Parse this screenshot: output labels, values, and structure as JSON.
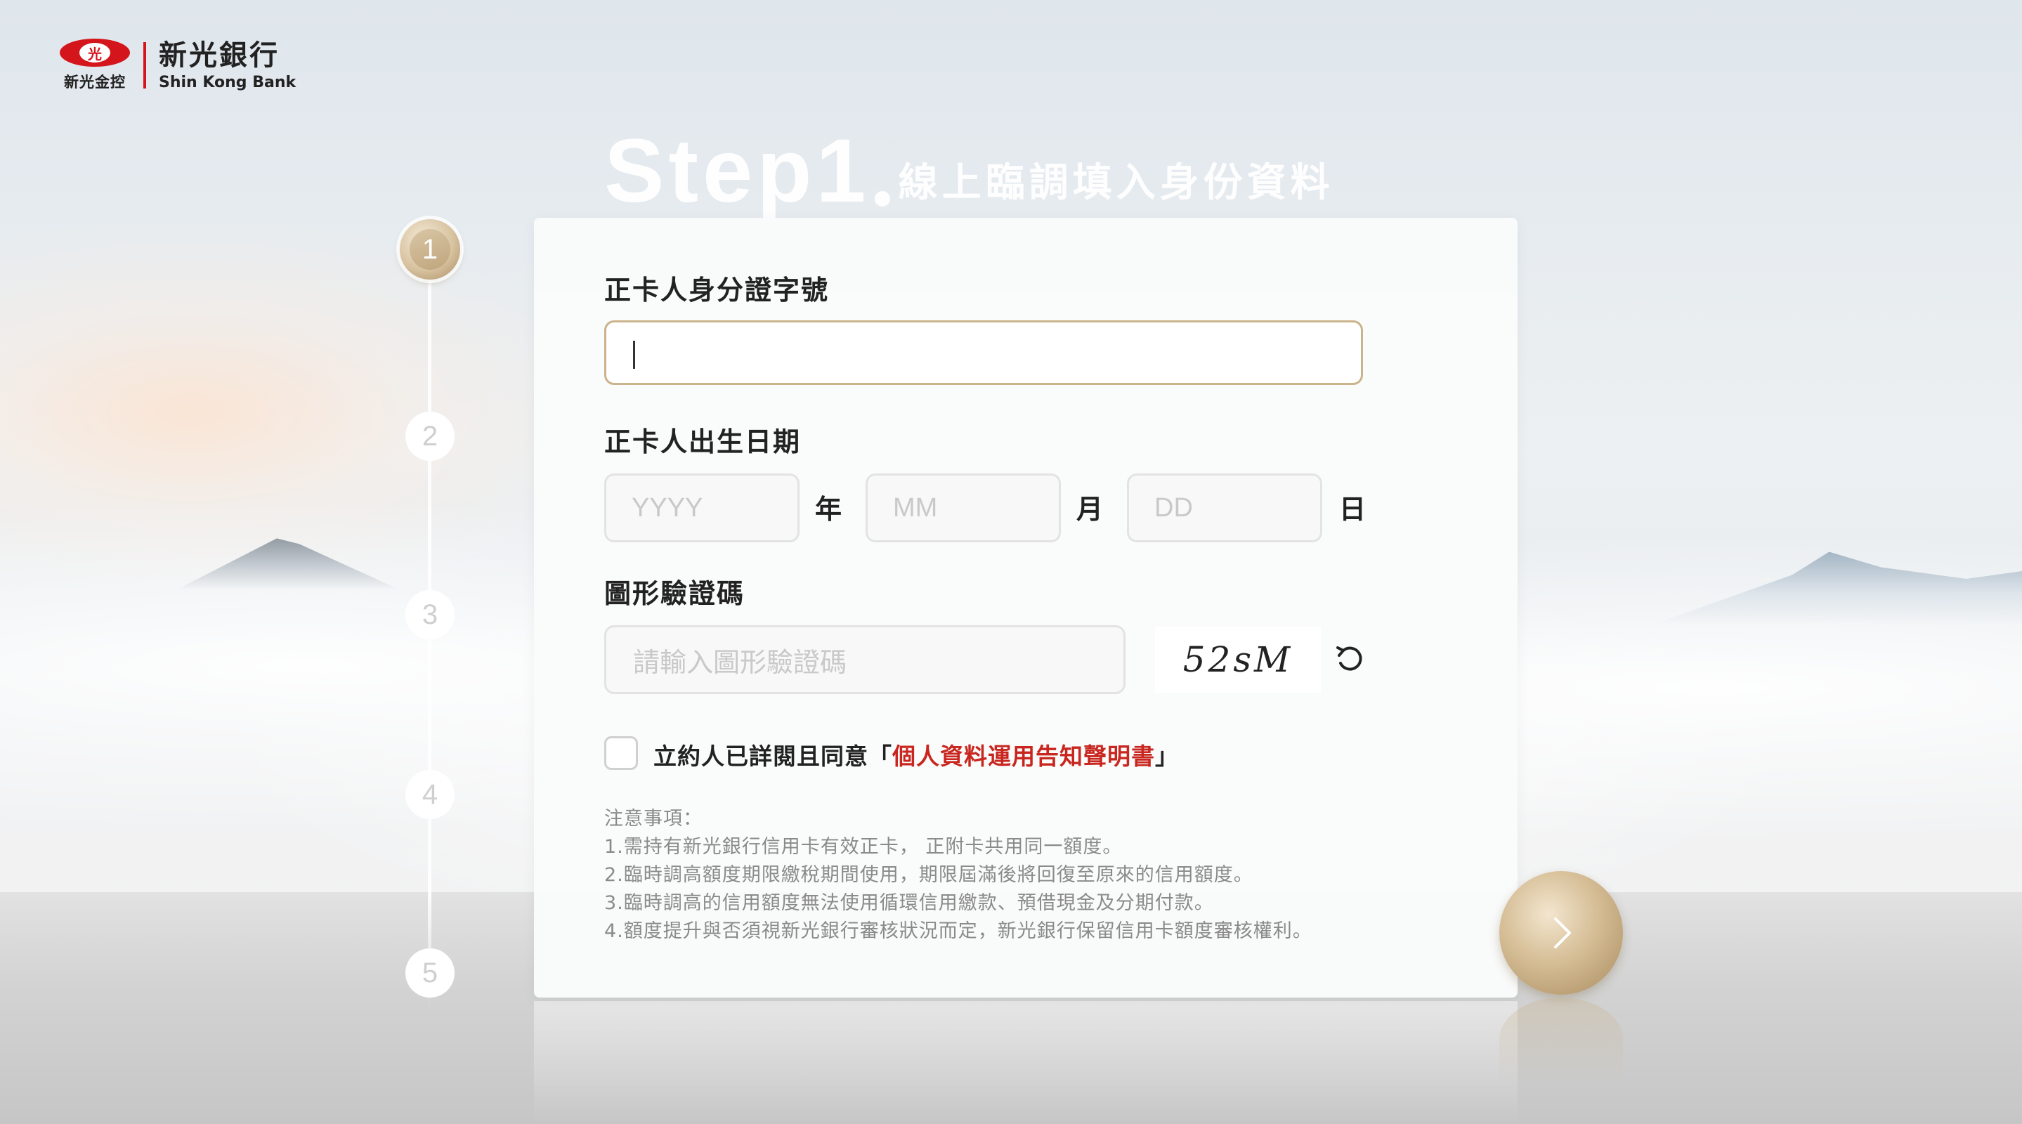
{
  "brand": {
    "logo_mark_text": "光",
    "group_name": "新光金控",
    "bank_name_cn": "新光銀行",
    "bank_name_en": "Shin Kong Bank"
  },
  "heading": {
    "step": "Step1",
    "title": "線上臨調填入身份資料"
  },
  "stepper": {
    "current": 1,
    "steps": [
      "1",
      "2",
      "3",
      "4",
      "5"
    ]
  },
  "form": {
    "id_label": "正卡人身分證字號",
    "id_value": "",
    "birth_label": "正卡人出生日期",
    "year_placeholder": "YYYY",
    "year_unit": "年",
    "month_placeholder": "MM",
    "month_unit": "月",
    "day_placeholder": "DD",
    "day_unit": "日",
    "captcha_label": "圖形驗證碼",
    "captcha_placeholder": "請輸入圖形驗證碼",
    "captcha_code": "52sM",
    "agree_prefix": "立約人已詳閱且同意「",
    "agree_link": "個人資料運用告知聲明書",
    "agree_suffix": "」",
    "agree_checked": false
  },
  "notes": {
    "title": "注意事項：",
    "items": [
      "1.需持有新光銀行信用卡有效正卡， 正附卡共用同一額度。",
      "2.臨時調高額度期限繳稅期間使用，期限屆滿後將回復至原來的信用額度。",
      "3.臨時調高的信用額度無法使用循環信用繳款、預借現金及分期付款。",
      "4.額度提升與否須視新光銀行審核狀況而定，新光銀行保留信用卡額度審核權利。"
    ]
  },
  "colors": {
    "brand_red": "#d4151c",
    "gold": "#cbb38b",
    "link_red": "#c8261e"
  },
  "icons": {
    "refresh": "refresh-icon",
    "next": "chevron-right-icon"
  }
}
